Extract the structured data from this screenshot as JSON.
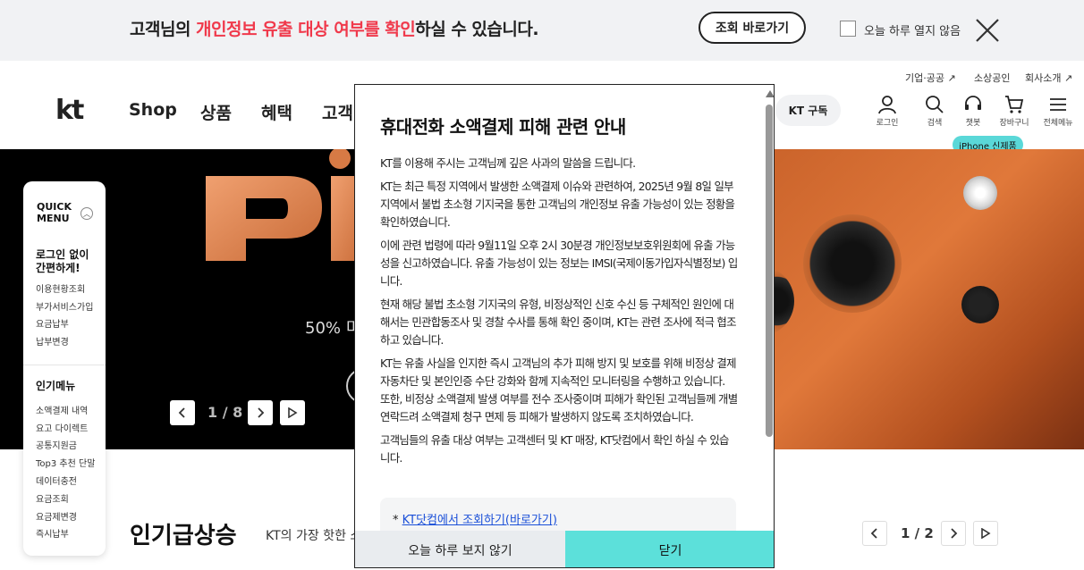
{
  "notice": {
    "prefix": "고객님의 ",
    "highlight": "개인정보 유출 대상 여부를 확인",
    "suffix": "하실 수 있습니다.",
    "button": "조회 바로가기",
    "checkbox_label": "오늘 하루 열지 않음"
  },
  "util_links": [
    "기업·공공",
    "소상공인",
    "회사소개"
  ],
  "logo": "kt",
  "gnb": [
    "Shop",
    "상품",
    "혜택",
    "고객"
  ],
  "kt_subscribe": "KT 구독",
  "header_icons": [
    {
      "label": "로그인",
      "icon": "user-icon"
    },
    {
      "label": "검색",
      "icon": "search-icon"
    },
    {
      "label": "챗봇",
      "icon": "headset-icon"
    },
    {
      "label": "장바구니",
      "icon": "cart-icon"
    },
    {
      "label": "전체메뉴",
      "icon": "menu-icon"
    }
  ],
  "iphone_badge": "iPhone 신제품",
  "hero": {
    "text_partial": "50% 미",
    "pager": "1 / 8"
  },
  "quick_menu": {
    "title_line1": "QUICK",
    "title_line2": "MENU",
    "login_head_line1": "로그인 없이",
    "login_head_line2": "간편하게!",
    "login_items": [
      "이용현황조회",
      "부가서비스가입",
      "요금납부",
      "납부변경"
    ],
    "popular_head": "인기메뉴",
    "popular_items": [
      "소액결제 내역",
      "요고 다이렉트",
      "공통지원금",
      "Top3 추천 단말",
      "데이터충전",
      "요금조회",
      "요금제변경",
      "즉시납부"
    ]
  },
  "section": {
    "title": "인기급상승",
    "subtitle": "KT의 가장 핫한 소",
    "pager": "1 / 2"
  },
  "modal": {
    "title": "휴대전화 소액결제 피해 관련 안내",
    "paragraphs": [
      "KT를 이용해 주시는 고객님께 깊은 사과의 말씀을 드립니다.",
      "KT는 최근 특정 지역에서 발생한 소액결제 이슈와 관련하여, 2025년 9월 8일 일부 지역에서 불법 초소형 기지국을 통한 고객님의 개인정보 유출 가능성이 있는 정황을 확인하였습니다.",
      "이에 관련 법령에 따라 9월11일 오후 2시 30분경 개인정보보호위원회에 유출 가능성을 신고하였습니다. 유출 가능성이 있는 정보는 IMSI(국제이동가입자식별정보) 입니다.",
      "현재 해당 불법 초소형 기지국의 유형, 비정상적인 신호 수신 등 구체적인 원인에 대해서는 민관합동조사 및 경찰 수사를 통해 확인 중이며, KT는 관련 조사에 적극 협조하고 있습니다.",
      "KT는 유출 사실을 인지한 즉시 고객님의 추가 피해 방지 및 보호를 위해 비정상 결제 자동차단 및 본인인증 수단 강화와 함께 지속적인 모니터링을 수행하고 있습니다.",
      "또한, 비정상 소액결제 발생 여부를 전수 조사중이며 피해가 확인된 고객님들께 개별 연락드려 소액결제 청구 면제 등 피해가 발생하지 않도록 조치하였습니다.",
      "고객님들의 유출 대상 여부는 고객센터 및 KT 매장, KT닷컴에서 확인 하실 수 있습니다."
    ],
    "link_prefix": "* ",
    "link_text": "KT닷컴에서 조회하기(바로가기)",
    "btn_dont_show": "오늘 하루 보지 않기",
    "btn_close": "닫기"
  }
}
